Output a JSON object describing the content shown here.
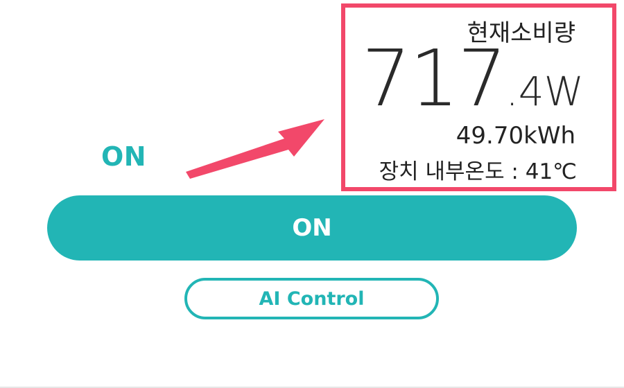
{
  "colors": {
    "accent": "#22b5b5",
    "highlight": "#f2486a",
    "text": "#222222"
  },
  "status": {
    "label": "ON"
  },
  "power_panel": {
    "title": "현재소비량",
    "power_integer": "717",
    "power_decimal": ".4W",
    "energy": "49.70kWh",
    "temperature": "장치 내부온도 : 41℃"
  },
  "controls": {
    "on_button_label": "ON",
    "ai_control_label": "AI Control"
  },
  "icons": {
    "arrow": "arrow-pointer-icon"
  }
}
